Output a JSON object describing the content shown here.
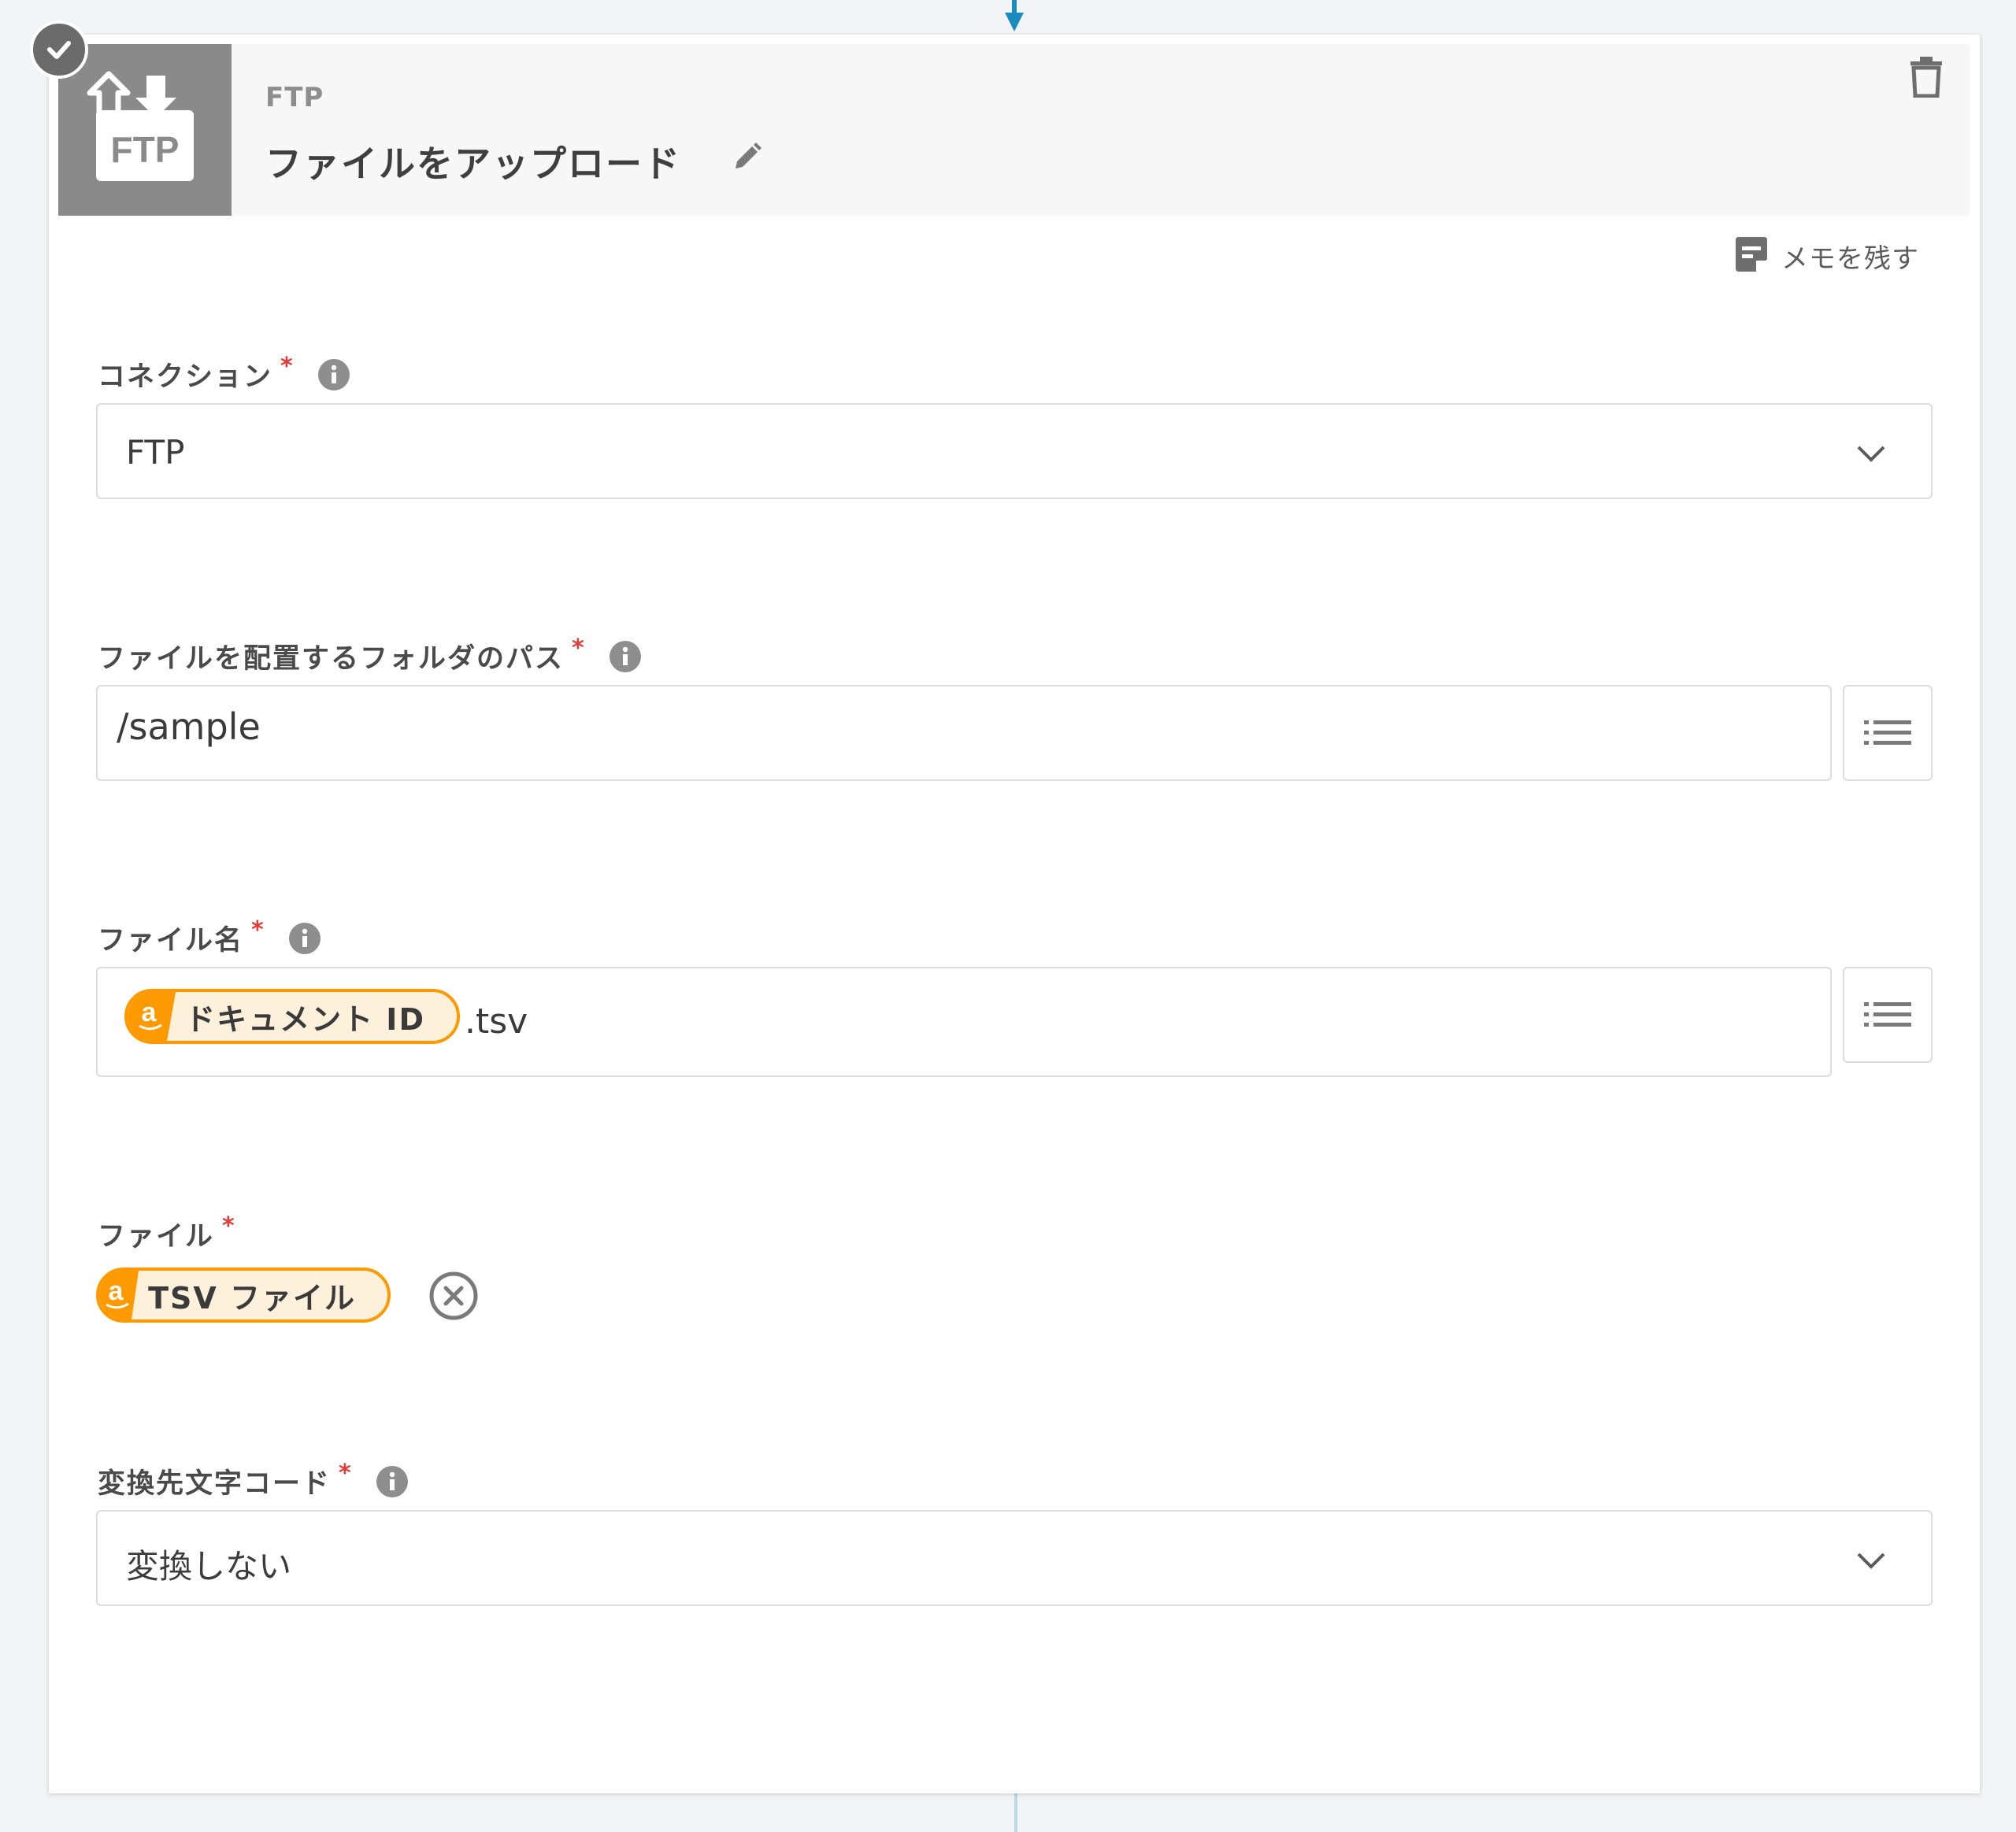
{
  "header": {
    "service_name": "FTP",
    "action_title": "ファイルをアップロード",
    "logo_text": "FTP"
  },
  "memo": {
    "label": "メモを残す"
  },
  "fields": {
    "connection": {
      "label": "コネクション",
      "required": "*",
      "value": "FTP"
    },
    "folder_path": {
      "label": "ファイルを配置するフォルダのパス",
      "required": "*",
      "value": "/sample"
    },
    "file_name": {
      "label": "ファイル名",
      "required": "*",
      "token": {
        "icon_text": "a",
        "label": "ドキュメント ID"
      },
      "suffix": ".tsv"
    },
    "file": {
      "label": "ファイル",
      "required": "*",
      "token": {
        "icon_text": "a",
        "label": "TSV ファイル"
      }
    },
    "encoding": {
      "label": "変換先文字コード",
      "required": "*",
      "value": "変換しない"
    }
  },
  "colors": {
    "accent": "#ff9900",
    "required": "#e53935",
    "connector": "#1a8cc0"
  },
  "icons": [
    "check-icon",
    "ftp-logo-icon",
    "pencil-icon",
    "trash-icon",
    "memo-icon",
    "info-icon",
    "chevron-down-icon",
    "list-icon",
    "amazon-icon",
    "clear-icon"
  ]
}
